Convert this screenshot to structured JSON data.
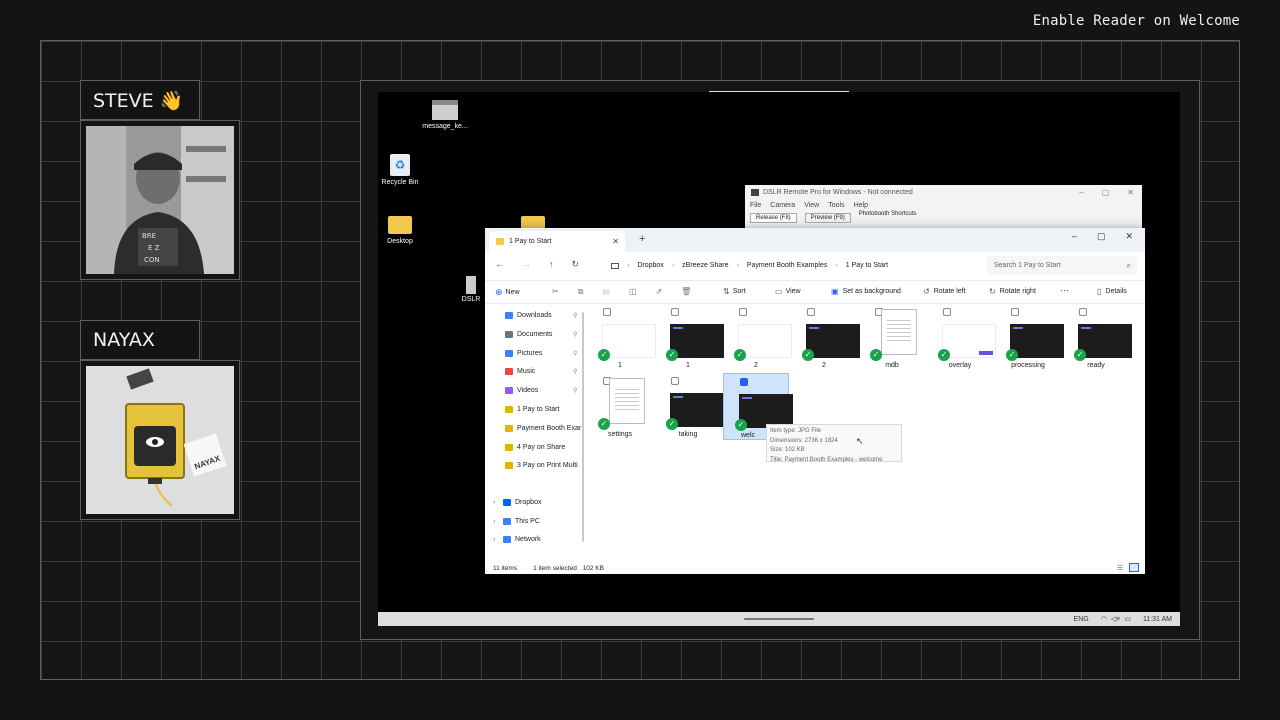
{
  "header": {
    "title": "Enable Reader on Welcome"
  },
  "panels": {
    "steve": {
      "name": "STEVE 👋"
    },
    "nayax": {
      "name": "NAYAX",
      "device_label": "NAYAX"
    }
  },
  "desktop": {
    "icons": [
      {
        "label": "message_ke..."
      },
      {
        "label": "Recycle Bin"
      },
      {
        "label": "Desktop"
      },
      {
        "label": "DSLR"
      }
    ]
  },
  "dslr_window": {
    "title": "DSLR Remote Pro for Windows - Not connected",
    "menu": [
      "File",
      "Camera",
      "View",
      "Tools",
      "Help"
    ],
    "tabs": [
      "Release (F8)",
      "Preview (F9)"
    ],
    "shortcuts_label": "Photobooth Shortcuts"
  },
  "explorer": {
    "tab_title": "1 Pay to Start",
    "breadcrumb": [
      "Dropbox",
      "zBreeze Share",
      "Payment Booth Examples",
      "1 Pay to Start"
    ],
    "search_placeholder": "Search 1 Pay to Start",
    "toolbar": {
      "new": "New",
      "sort": "Sort",
      "view": "View",
      "set_bg": "Set as background",
      "rotate_left": "Rotate left",
      "rotate_right": "Rotate right",
      "more": "···",
      "details": "Details"
    },
    "nav": [
      {
        "label": "Downloads",
        "color": "#3b82f6"
      },
      {
        "label": "Documents",
        "color": "#6b7280"
      },
      {
        "label": "Pictures",
        "color": "#3b82f6"
      },
      {
        "label": "Music",
        "color": "#ef4444"
      },
      {
        "label": "Videos",
        "color": "#8b5cf6"
      },
      {
        "label": "1 Pay to Start",
        "color": "#e0b400"
      },
      {
        "label": "Payment Booth Exar",
        "color": "#e0b400"
      },
      {
        "label": "4 Pay on Share",
        "color": "#e0b400"
      },
      {
        "label": "3 Pay on Print Multi",
        "color": "#e0b400"
      }
    ],
    "nav_roots": [
      {
        "label": "Dropbox",
        "color": "#0061fe"
      },
      {
        "label": "This PC",
        "color": "#3b82f6"
      },
      {
        "label": "Network",
        "color": "#3b82f6"
      }
    ],
    "files": [
      {
        "name": "1",
        "kind": "white"
      },
      {
        "name": "1",
        "kind": "dark"
      },
      {
        "name": "2",
        "kind": "white"
      },
      {
        "name": "2",
        "kind": "dark"
      },
      {
        "name": "mdb",
        "kind": "doc"
      },
      {
        "name": "overlay",
        "kind": "white"
      },
      {
        "name": "processing",
        "kind": "dark"
      },
      {
        "name": "ready",
        "kind": "dark"
      },
      {
        "name": "settings",
        "kind": "doc"
      },
      {
        "name": "taking",
        "kind": "dark"
      },
      {
        "name": "welc",
        "kind": "dark-selected"
      }
    ],
    "tooltip": [
      "Item type: JPG File",
      "Dimensions: 2736 x 1824",
      "Size: 102 KB",
      "Title: Payment Booth Examples - welcome"
    ],
    "status": {
      "count": "11 items",
      "selection": "1 item selected",
      "size": "102 KB"
    }
  },
  "taskbar": {
    "lang": "ENG",
    "time": "11:31 AM"
  }
}
